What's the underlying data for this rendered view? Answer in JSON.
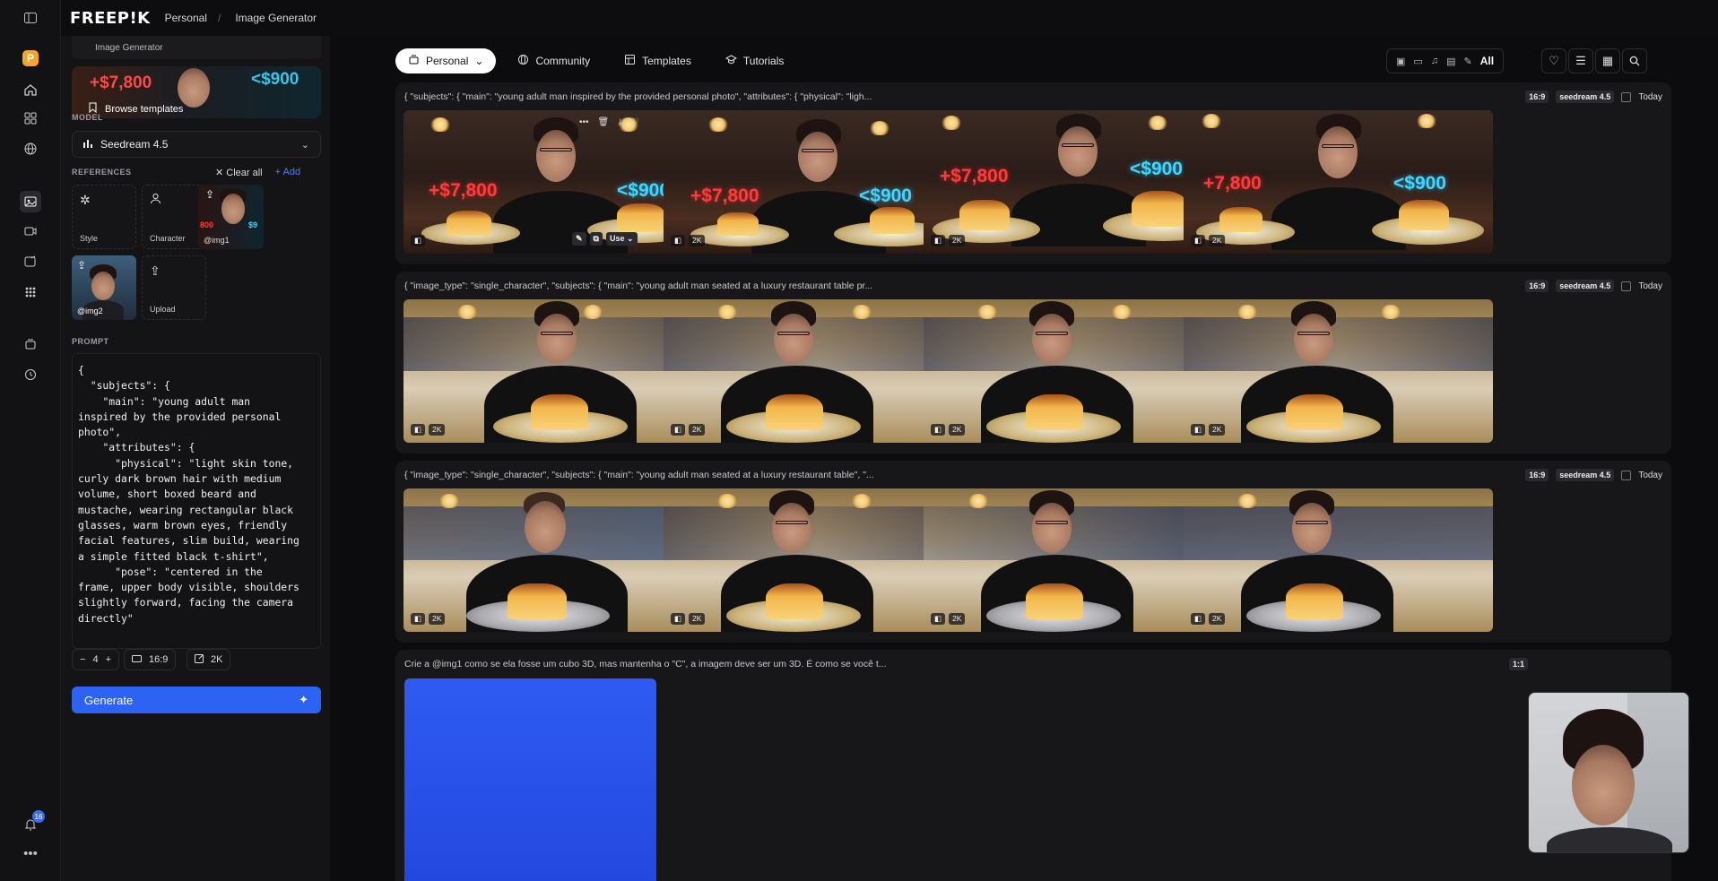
{
  "app": {
    "logo": "FREEP!K",
    "breadcrumb": [
      "Personal",
      "/",
      "Image Generator"
    ]
  },
  "rail": {
    "brand_letter": "P",
    "notification_count": "16",
    "icons": [
      "sidebar-toggle-icon",
      "home-icon",
      "apps-grid-icon",
      "globe-icon",
      "image-icon",
      "video-icon",
      "edit-icon",
      "grid-dots-icon",
      "stack-icon",
      "history-icon",
      "bell-icon",
      "more-icon"
    ]
  },
  "panel": {
    "tool_header": "Image Generator",
    "template_banner": {
      "price_left": "+$7,800",
      "price_right": "<$900",
      "label": "Browse templates"
    },
    "model_label": "MODEL",
    "model_value": "Seedream 4.5",
    "references_label": "REFERENCES",
    "clear_all": "Clear all",
    "add": "Add",
    "ref_tiles": [
      {
        "label": "Style"
      },
      {
        "label": "Character"
      },
      {
        "label": "@img1"
      },
      {
        "label": "@img2"
      },
      {
        "label": "Upload"
      }
    ],
    "prompt_label": "PROMPT",
    "prompt_text": "{\n  \"subjects\": {\n    \"main\": \"young adult man\ninspired by the provided personal\nphoto\",\n    \"attributes\": {\n      \"physical\": \"light skin tone,\ncurly dark brown hair with medium\nvolume, short boxed beard and\nmustache, wearing rectangular black\nglasses, warm brown eyes, friendly\nfacial features, slim build, wearing\na simple fitted black t-shirt\",\n      \"pose\": \"centered in the\nframe, upper body visible, shoulders\nslightly forward, facing the camera\ndirectly\"",
    "count": "4",
    "aspect": "16:9",
    "resolution": "2K",
    "generate": "Generate"
  },
  "main": {
    "tabs": [
      {
        "label": "Personal",
        "active": true
      },
      {
        "label": "Community",
        "active": false
      },
      {
        "label": "Templates",
        "active": false
      },
      {
        "label": "Tutorials",
        "active": false
      }
    ],
    "filter_all": "All",
    "rows": [
      {
        "prompt": "{ \"subjects\": { \"main\": \"young adult man inspired by the provided personal photo\", \"attributes\": { \"physical\": \"ligh...",
        "aspect": "16:9",
        "model": "seedream 4.5",
        "date": "Today",
        "images": [
          {
            "res": "",
            "price_left": "+$7,800",
            "price_right": "<$900",
            "use_label": "Use"
          },
          {
            "res": "2K",
            "price_left": "+$7,800",
            "price_right": "<$900"
          },
          {
            "res": "2K",
            "price_left": "+$7,800",
            "price_right": "<$900"
          },
          {
            "res": "2K",
            "price_left": "+7,800",
            "price_right": "<$900"
          }
        ]
      },
      {
        "prompt": "{ \"image_type\": \"single_character\", \"subjects\": { \"main\": \"young adult man seated at a luxury restaurant table pr...",
        "aspect": "16:9",
        "model": "seedream 4.5",
        "date": "Today",
        "images": [
          {
            "res": "2K"
          },
          {
            "res": "2K"
          },
          {
            "res": "2K"
          },
          {
            "res": "2K"
          }
        ]
      },
      {
        "prompt": "{ \"image_type\": \"single_character\", \"subjects\": { \"main\": \"young adult man seated at a luxury restaurant table\", \"...",
        "aspect": "16:9",
        "model": "seedream 4.5",
        "date": "Today",
        "images": [
          {
            "res": "2K"
          },
          {
            "res": "2K"
          },
          {
            "res": "2K"
          },
          {
            "res": "2K"
          }
        ]
      },
      {
        "prompt": "Crie a @img1 como se ela fosse um cubo 3D, mas mantenha o \"C\", a imagem deve ser um 3D. É como se você t...",
        "aspect": "1:1"
      }
    ]
  },
  "colors": {
    "accent": "#2d63f3",
    "price_red": "#ff3b3b",
    "price_cyan": "#3fd6ff"
  }
}
